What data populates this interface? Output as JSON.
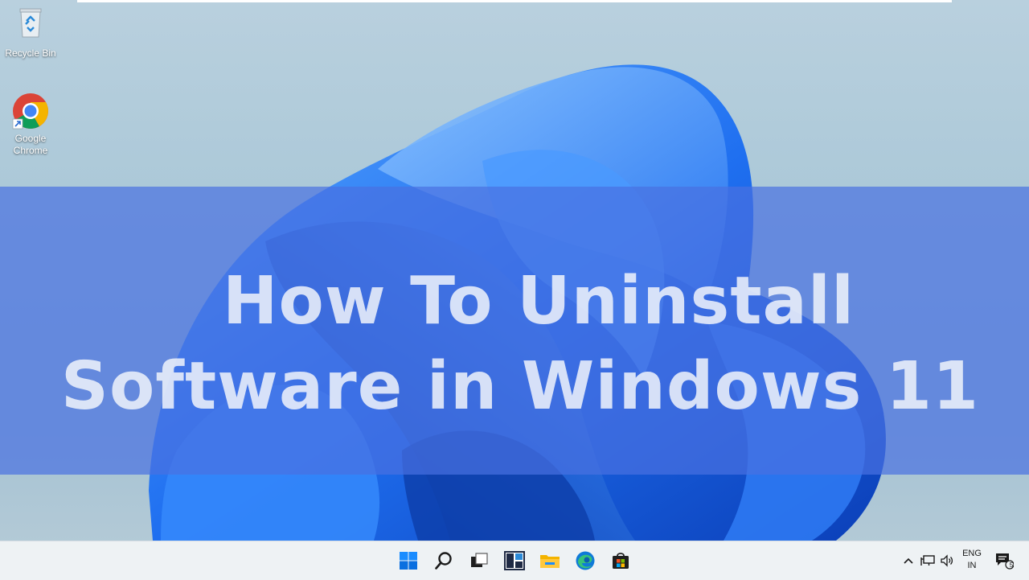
{
  "desktop": {
    "icons": [
      {
        "label": "Recycle Bin",
        "icon": "recycle-bin-icon"
      },
      {
        "label": "Google Chrome",
        "label_line1": "Google",
        "label_line2": "Chrome",
        "icon": "chrome-icon"
      }
    ]
  },
  "overlay": {
    "title_line1": "How To Uninstall",
    "title_line2": "Software in Windows 11",
    "band_color": "#4870e1"
  },
  "taskbar": {
    "apps": [
      {
        "name": "Start",
        "icon": "windows-start-icon"
      },
      {
        "name": "Search",
        "icon": "search-icon"
      },
      {
        "name": "Task View",
        "icon": "task-view-icon"
      },
      {
        "name": "Widgets",
        "icon": "widgets-icon"
      },
      {
        "name": "File Explorer",
        "icon": "file-explorer-icon"
      },
      {
        "name": "Microsoft Edge",
        "icon": "edge-icon"
      },
      {
        "name": "Microsoft Store",
        "icon": "store-icon"
      }
    ],
    "tray": {
      "language_line1": "ENG",
      "language_line2": "IN",
      "notification_count": "5"
    }
  },
  "colors": {
    "accent": "#0067c0",
    "wallpaper_blue": "#1a6cf0"
  }
}
